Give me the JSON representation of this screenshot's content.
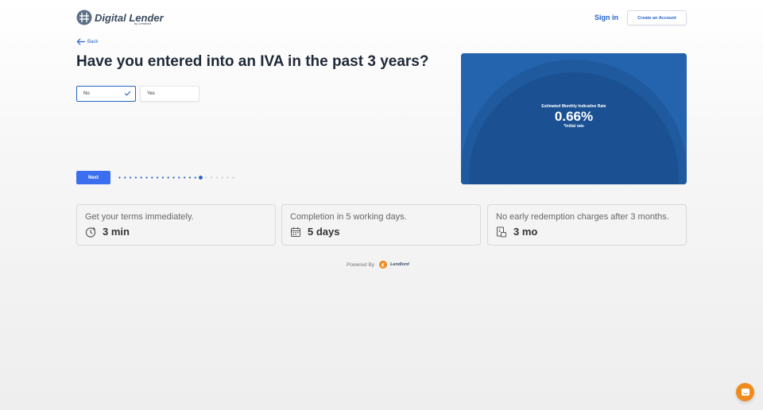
{
  "brand": {
    "name": "Digital Lender",
    "sub": "by Lendlord"
  },
  "nav": {
    "signin": "Sign in",
    "create_account": "Create an Account"
  },
  "back_label": "Back",
  "question": "Have you entered into an IVA in the past 3 years?",
  "options": {
    "selected": "No",
    "other": "Yes"
  },
  "next_label": "Next",
  "progress": {
    "total_steps": 22,
    "current_step": 16
  },
  "rate_card": {
    "label": "Estimated Monthly Indicative Rate",
    "value": "0.66%",
    "note": "*Initial rate"
  },
  "features": [
    {
      "title": "Get your terms immediately.",
      "value": "3 min",
      "icon": "clock-icon"
    },
    {
      "title": "Completion in 5 working days.",
      "value": "5 days",
      "icon": "calendar-icon"
    },
    {
      "title": "No early redemption charges after 3 months.",
      "value": "3 mo",
      "icon": "pound-document-icon"
    }
  ],
  "footer": {
    "powered_by": "Powered By",
    "provider": "Lendlord"
  },
  "colors": {
    "accent": "#2563c9",
    "button": "#3b6ff0",
    "card": "#2463ad",
    "chat": "#f08a1d"
  }
}
